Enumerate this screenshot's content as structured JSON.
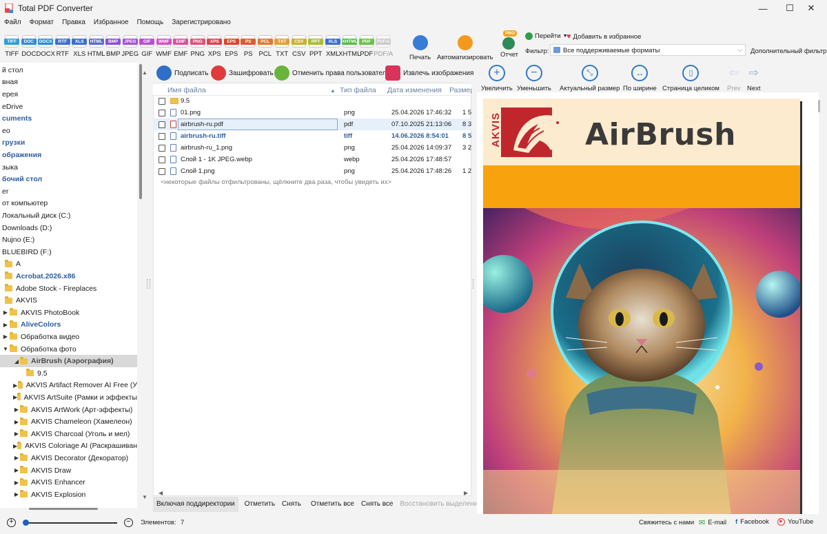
{
  "window": {
    "title": "Total PDF Converter",
    "controls": [
      "—",
      "☐",
      "✕"
    ]
  },
  "menu": [
    "Файл",
    "Формат",
    "Правка",
    "Избранное",
    "Помощь",
    "Зарегистрировано"
  ],
  "formats": [
    {
      "label": "TIFF",
      "icon": "TIFF",
      "color": "#2a9fd6"
    },
    {
      "label": "DOC",
      "icon": "DOC",
      "color": "#2a8fd6"
    },
    {
      "label": "DOCX",
      "icon": "DOCX",
      "color": "#2a8fd6"
    },
    {
      "label": "RTF",
      "icon": "RTF",
      "color": "#3d6fd1"
    },
    {
      "label": "XLS",
      "icon": "XLS",
      "color": "#3d6fd1"
    },
    {
      "label": "HTML",
      "icon": "HTML",
      "color": "#5b6ad6"
    },
    {
      "label": "BMP",
      "icon": "BMP",
      "color": "#8a4fd6"
    },
    {
      "label": "JPEG",
      "icon": "JPEG",
      "color": "#a24fd6"
    },
    {
      "label": "GIF",
      "icon": "GIF",
      "color": "#b94fd6"
    },
    {
      "label": "WMF",
      "icon": "WMF",
      "color": "#d64fc7"
    },
    {
      "label": "EMF",
      "icon": "EMF",
      "color": "#e04f9c"
    },
    {
      "label": "PNG",
      "icon": "PNG",
      "color": "#e04f7c"
    },
    {
      "label": "XPS",
      "icon": "XPS",
      "color": "#e0414f"
    },
    {
      "label": "EPS",
      "icon": "EPS",
      "color": "#e0412f"
    },
    {
      "label": "PS",
      "icon": "PS",
      "color": "#e05a2f"
    },
    {
      "label": "PCL",
      "icon": "PCL",
      "color": "#e07a2f"
    },
    {
      "label": "TXT",
      "icon": "TXT",
      "color": "#e0a02f"
    },
    {
      "label": "CSV",
      "icon": "CSV",
      "color": "#c9b22a"
    },
    {
      "label": "PPT",
      "icon": "PPT",
      "color": "#a8c02a"
    },
    {
      "label": "XML",
      "icon": "XLS",
      "color": "#3d6fd1"
    },
    {
      "label": "XHTML",
      "icon": "XHTML",
      "color": "#58b84a"
    },
    {
      "label": "PDF",
      "icon": "PDF",
      "color": "#6cc04a"
    },
    {
      "label": "PDF/A",
      "icon": "PDF/A",
      "color": "#9a9a9a",
      "disabled": true
    }
  ],
  "toolbar": {
    "print": "Печать",
    "automate": "Автоматизировать",
    "report": "Отчет",
    "pro_badge": "PRO",
    "goto": "Перейти",
    "add_favorite": "Добавить в избранное",
    "filter_label": "Фильтр:",
    "filter_value": "Все поддерживаемые форматы",
    "extra_filter": "Дополнительный фильтр"
  },
  "tree": [
    {
      "label": "й стол",
      "indent": 0,
      "arrow": ""
    },
    {
      "label": "вная",
      "indent": 0,
      "arrow": ""
    },
    {
      "label": "ерея",
      "indent": 0,
      "arrow": ""
    },
    {
      "label": "eDrive",
      "indent": 0,
      "arrow": ""
    },
    {
      "label": "cuments",
      "indent": 0,
      "arrow": "",
      "bold": true
    },
    {
      "label": "ео",
      "indent": 0,
      "arrow": ""
    },
    {
      "label": "грузки",
      "indent": 0,
      "arrow": "",
      "bold": true
    },
    {
      "label": "ображения",
      "indent": 0,
      "arrow": "",
      "bold": true
    },
    {
      "label": "зыка",
      "indent": 0,
      "arrow": ""
    },
    {
      "label": "бочий стол",
      "indent": 0,
      "arrow": "",
      "bold": true
    },
    {
      "label": "er",
      "indent": 0,
      "arrow": ""
    },
    {
      "label": "от компьютер",
      "indent": 0,
      "arrow": ""
    },
    {
      "label": "Локальный диск (C:)",
      "indent": 0,
      "arrow": ""
    },
    {
      "label": "Downloads (D:)",
      "indent": 0,
      "arrow": ""
    },
    {
      "label": "Nujno (E:)",
      "indent": 0,
      "arrow": ""
    },
    {
      "label": "BLUEBIRD (F:)",
      "indent": 0,
      "arrow": ""
    },
    {
      "label": "A",
      "indent": 1,
      "arrow": "",
      "folder": true
    },
    {
      "label": "Acrobat.2026.x86",
      "indent": 1,
      "arrow": "",
      "folder": true,
      "bold": true
    },
    {
      "label": "Adobe Stock - Fireplaces",
      "indent": 1,
      "arrow": "",
      "folder": true
    },
    {
      "label": "AKVIS",
      "indent": 1,
      "arrow": "",
      "folder": true
    },
    {
      "label": "AKVIS PhotoBook",
      "indent": 2,
      "arrow": "▶",
      "folder": true
    },
    {
      "label": "AliveColors",
      "indent": 2,
      "arrow": "▶",
      "folder": true,
      "bold": true
    },
    {
      "label": "Обработка видео",
      "indent": 2,
      "arrow": "▶",
      "folder": true
    },
    {
      "label": "Обработка фото",
      "indent": 2,
      "arrow": "▼",
      "folder": true
    },
    {
      "label": "AirBrush (Аэрография)",
      "indent": 3,
      "arrow": "◢",
      "folder": true,
      "bold": true,
      "selected": true
    },
    {
      "label": "9.5",
      "indent": 4,
      "arrow": "",
      "folder": true
    },
    {
      "label": "AKVIS Artifact Remover AI Free (У",
      "indent": 3,
      "arrow": "▶",
      "folder": true
    },
    {
      "label": "AKVIS ArtSuite (Рамки и эффекты",
      "indent": 3,
      "arrow": "▶",
      "folder": true
    },
    {
      "label": "AKVIS ArtWork (Арт-эффекты)",
      "indent": 3,
      "arrow": "▶",
      "folder": true
    },
    {
      "label": "AKVIS Chameleon (Хамелеон)",
      "indent": 3,
      "arrow": "▶",
      "folder": true
    },
    {
      "label": "AKVIS Charcoal (Уголь и мел)",
      "indent": 3,
      "arrow": "▶",
      "folder": true
    },
    {
      "label": "AKVIS Coloriage AI (Раскрашиван",
      "indent": 3,
      "arrow": "▶",
      "folder": true
    },
    {
      "label": "AKVIS Decorator (Декоратор)",
      "indent": 3,
      "arrow": "▶",
      "folder": true
    },
    {
      "label": "AKVIS Draw",
      "indent": 3,
      "arrow": "▶",
      "folder": true
    },
    {
      "label": "AKVIS Enhancer",
      "indent": 3,
      "arrow": "▶",
      "folder": true
    },
    {
      "label": "AKVIS Explosion",
      "indent": 3,
      "arrow": "▶",
      "folder": true
    }
  ],
  "actions": {
    "sign": "Подписать",
    "encrypt": "Зашифровать",
    "revoke": "Отменить права пользователя",
    "extract_images": "Извлечь изображения"
  },
  "file_columns": {
    "name": "Имя файла",
    "type": "Тип файла",
    "date": "Дата изменения",
    "size": "Размер"
  },
  "files": [
    {
      "name": "9.5",
      "type": "",
      "date": "",
      "size": "",
      "kind": "fold"
    },
    {
      "name": "01.png",
      "type": "png",
      "date": "25.04.2026 17:46:32",
      "size": "1 5",
      "kind": "img"
    },
    {
      "name": "airbrush-ru.pdf",
      "type": "pdf",
      "date": "07.10.2025 21:13:06",
      "size": "8 3",
      "kind": "pdf",
      "selected": true
    },
    {
      "name": "airbrush-ru.tiff",
      "type": "tiff",
      "date": "14.06.2026 8:54:01",
      "size": "8 53",
      "kind": "img",
      "bold": true
    },
    {
      "name": "airbrush-ru_1.png",
      "type": "png",
      "date": "25.04.2026 14:09:37",
      "size": "3 2",
      "kind": "img"
    },
    {
      "name": "Слой 1 - 1K JPEG.webp",
      "type": "webp",
      "date": "25.04.2026 17:48:57",
      "size": "",
      "kind": "img"
    },
    {
      "name": "Слой 1.png",
      "type": "png",
      "date": "25.04.2026 17:48:26",
      "size": "1 2",
      "kind": "img"
    }
  ],
  "filtered_note": "<некоторые файлы отфильтрованы, щёлкните два раза, чтобы увидеть их>",
  "selection_bar": {
    "include_subdirs": "Включая поддиректории",
    "check": "Отметить",
    "uncheck": "Снять",
    "check_all": "Отметить все",
    "uncheck_all": "Снять все",
    "restore": "Восстановить выделени"
  },
  "preview_toolbar": {
    "zoom_in": "Увеличить",
    "zoom_out": "Уменьшить",
    "actual_size": "Актуальный размер",
    "fit_width": "По ширине",
    "fit_page": "Страница целиком",
    "prev": "Prev",
    "next": "Next"
  },
  "preview_page": {
    "brand_vertical": "AKVIS",
    "title": "AirBrush"
  },
  "status": {
    "items_label": "Элементов:",
    "items_count": "7",
    "contact": "Свяжитесь с нами",
    "email": "E-mail",
    "facebook": "Facebook",
    "youtube": "YouTube"
  },
  "colors": {
    "accent_blue": "#2f78c8",
    "selected_tree": "#d9d9d9",
    "bold_blue": "#2e5d9f",
    "page_orange": "#f8a20e",
    "brand_red": "#c0272d"
  }
}
